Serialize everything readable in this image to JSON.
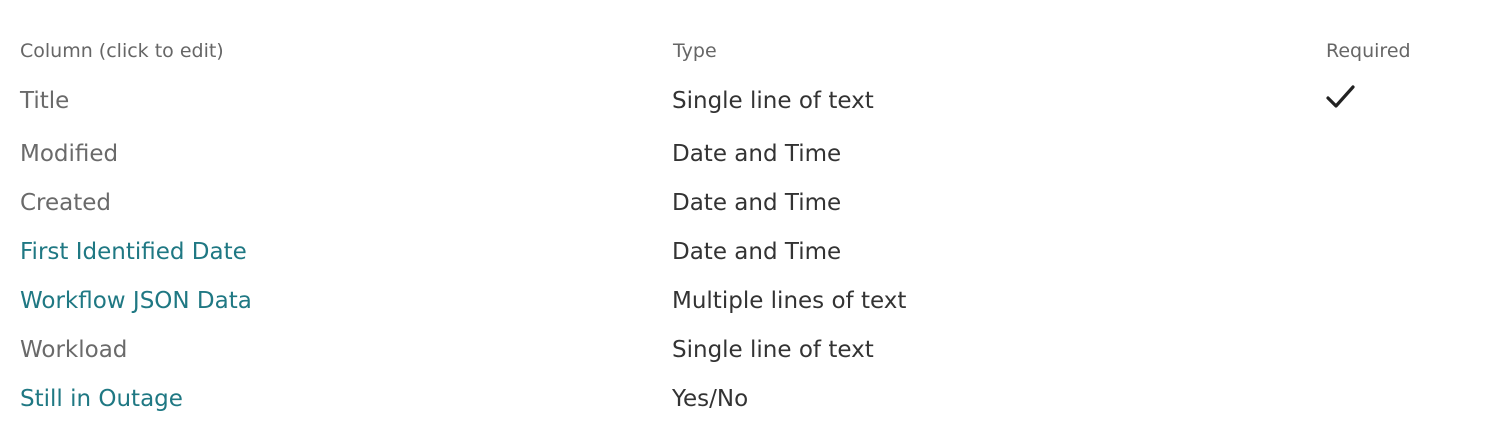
{
  "headers": {
    "column": "Column (click to edit)",
    "type": "Type",
    "required": "Required"
  },
  "rows": [
    {
      "name": "Title",
      "type": "Single line of text",
      "required": true,
      "link": false
    },
    {
      "name": "Modified",
      "type": "Date and Time",
      "required": false,
      "link": false
    },
    {
      "name": "Created",
      "type": "Date and Time",
      "required": false,
      "link": false
    },
    {
      "name": "First Identified Date",
      "type": "Date and Time",
      "required": false,
      "link": true
    },
    {
      "name": "Workflow JSON Data",
      "type": "Multiple lines of text",
      "required": false,
      "link": true
    },
    {
      "name": "Workload",
      "type": "Single line of text",
      "required": false,
      "link": false
    },
    {
      "name": "Still in Outage",
      "type": "Yes/No",
      "required": false,
      "link": true
    }
  ],
  "colors": {
    "link": "#1f7883",
    "plain": "#6a6a6a",
    "header": "#666666",
    "type": "#333333"
  },
  "icons": {
    "required": "checkmark-icon"
  }
}
